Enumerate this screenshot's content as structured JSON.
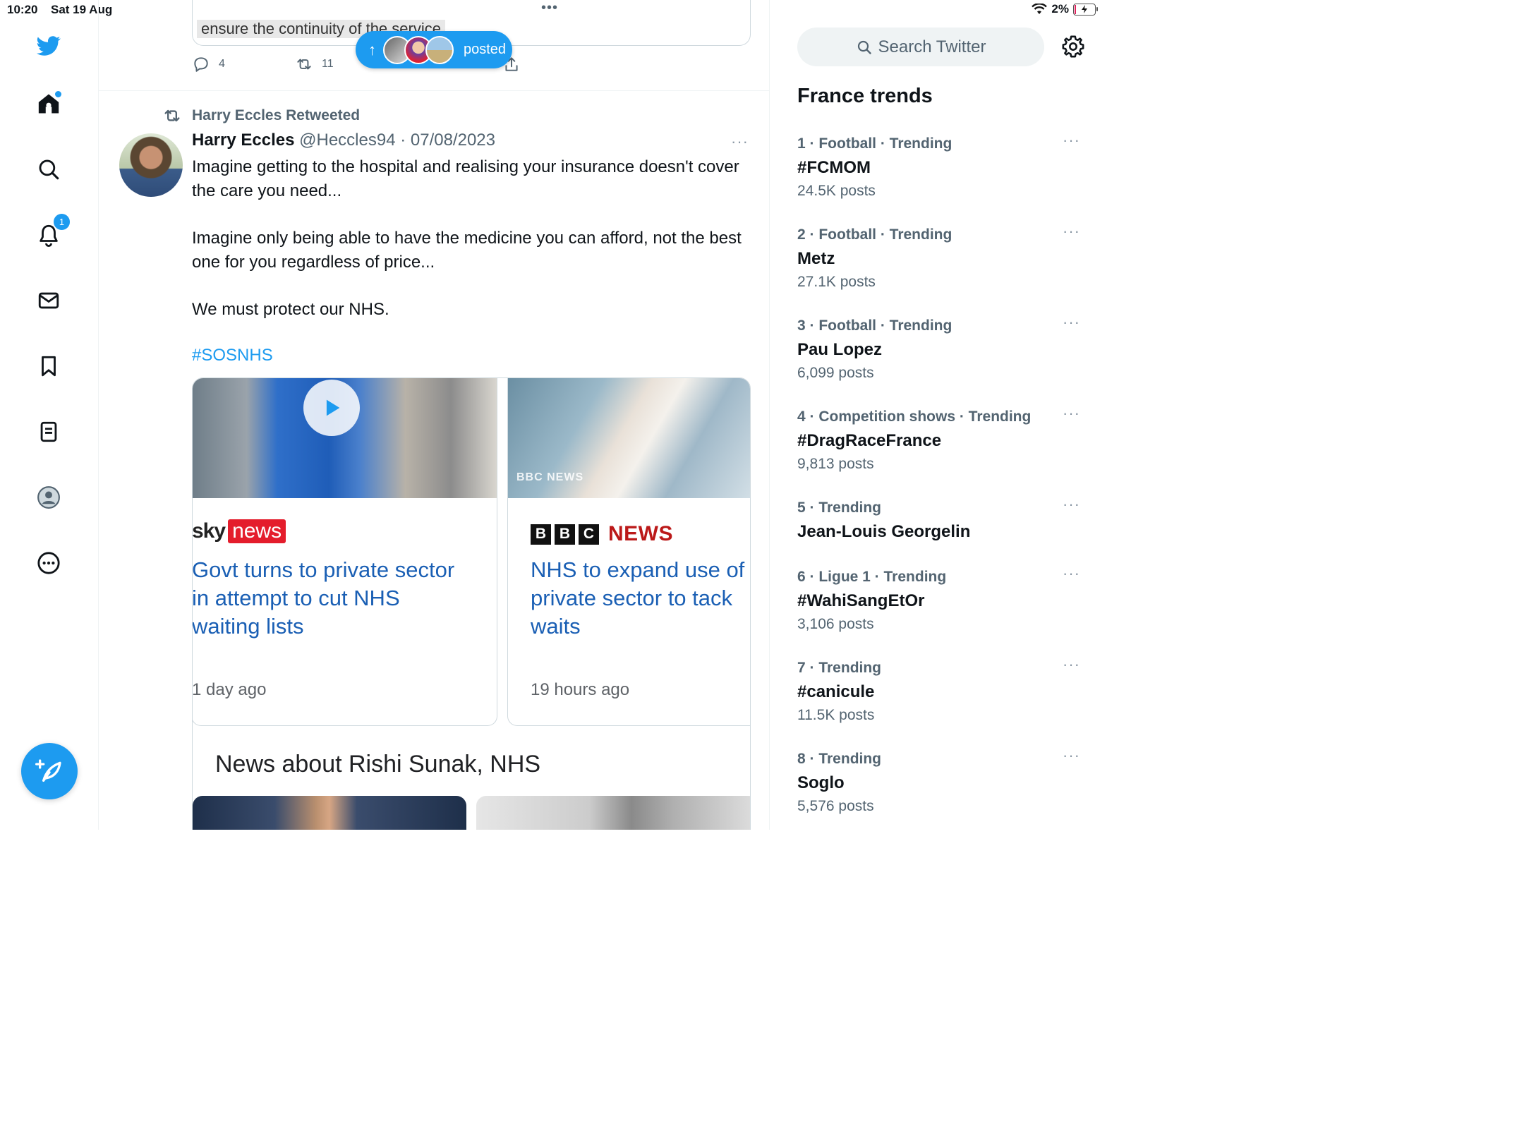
{
  "status_bar": {
    "time": "10:20",
    "date": "Sat 19 Aug",
    "dots": "•••",
    "battery": "2%"
  },
  "nav": {
    "items": [
      "twitter-logo",
      "home",
      "explore",
      "notifications",
      "messages",
      "bookmarks",
      "lists",
      "profile",
      "more"
    ],
    "notifications_count": "1"
  },
  "prev_tweet": {
    "quote_text": "ensure the continuity of the service",
    "replies": "4",
    "retweets": "11"
  },
  "posted_pill": {
    "label": "posted"
  },
  "tweet": {
    "retweet_label": "Harry Eccles Retweeted",
    "name": "Harry Eccles",
    "handle_date": "@Heccles94 · 07/08/2023",
    "more": "···",
    "paragraphs": [
      "Imagine getting to the hospital and realising your insurance doesn't cover the care you need...",
      "Imagine only being able to have the medicine you can afford, not the best one for you regardless of price...",
      "We must protect our NHS."
    ],
    "hashtag": "#SOSNHS"
  },
  "cards": [
    {
      "source_part1": "sky",
      "source_part2": "news",
      "headline_lines": [
        "Govt turns to private sector",
        "in attempt to cut NHS",
        "waiting lists"
      ],
      "time": "1 day ago"
    },
    {
      "watermark": "BBC NEWS",
      "logo_letters": [
        "B",
        "B",
        "C"
      ],
      "logo_text": "NEWS",
      "headline_lines": [
        "NHS to expand use of",
        "private sector to tack",
        "waits"
      ],
      "time": "19 hours ago"
    }
  ],
  "news_section_title": "News about Rishi Sunak, NHS",
  "sidebar": {
    "search_placeholder": "Search Twitter",
    "trends_title": "France trends",
    "trends": [
      {
        "meta": "1 · Football · Trending",
        "name": "#FCMOM",
        "count": "24.5K posts"
      },
      {
        "meta": "2 · Football · Trending",
        "name": "Metz",
        "count": "27.1K posts"
      },
      {
        "meta": "3 · Football · Trending",
        "name": "Pau Lopez",
        "count": "6,099 posts"
      },
      {
        "meta": "4 · Competition shows · Trending",
        "name": "#DragRaceFrance",
        "count": "9,813 posts"
      },
      {
        "meta": "5 · Trending",
        "name": "Jean-Louis Georgelin",
        "count": ""
      },
      {
        "meta": "6 · Ligue 1 · Trending",
        "name": "#WahiSangEtOr",
        "count": "3,106 posts"
      },
      {
        "meta": "7 · Trending",
        "name": "#canicule",
        "count": "11.5K posts"
      },
      {
        "meta": "8 · Trending",
        "name": "Soglo",
        "count": "5,576 posts"
      }
    ]
  },
  "colors": {
    "accent": "#1d9bf0",
    "secondary_text": "#536471",
    "link": "#1a5fb4",
    "sky_red": "#e41d2c",
    "bbc_red": "#bb1919"
  }
}
